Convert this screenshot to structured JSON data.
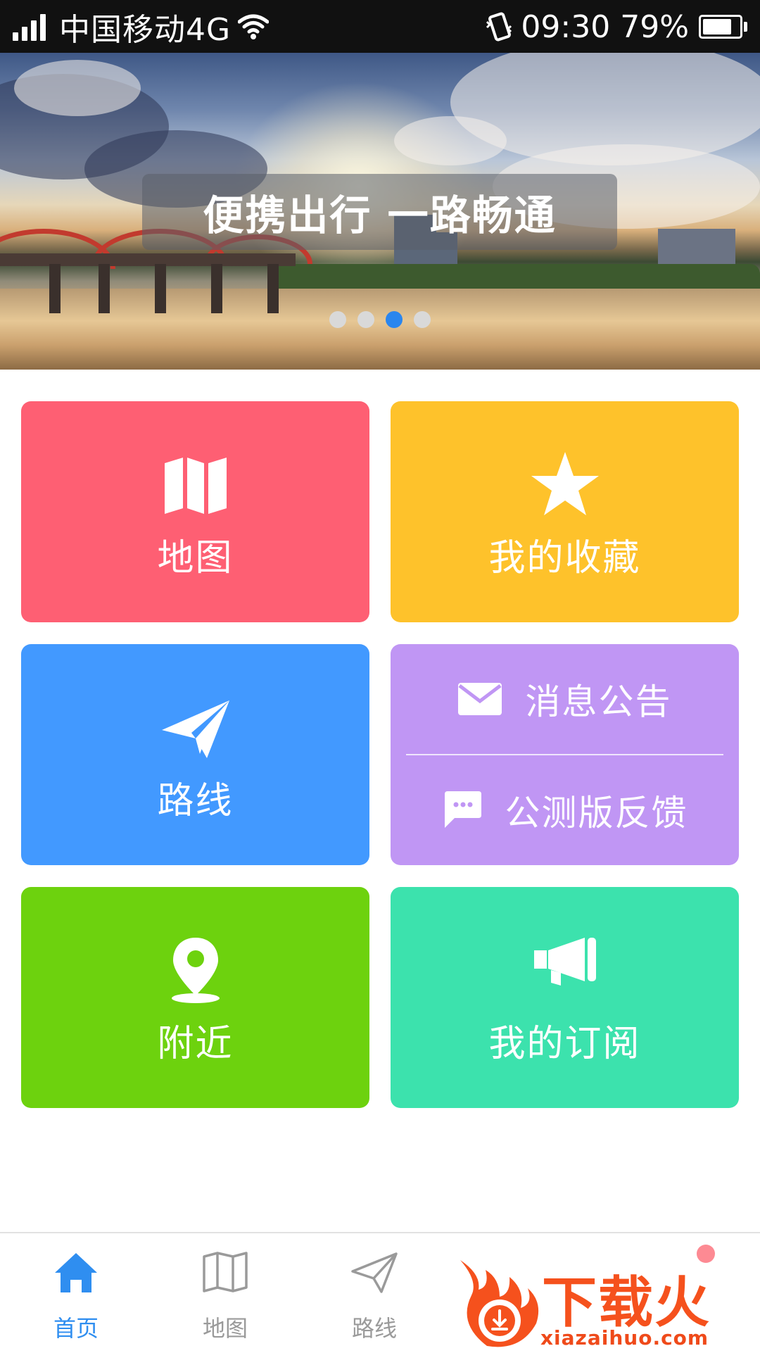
{
  "status_bar": {
    "carrier": "中国移动4G",
    "time": "09:30",
    "battery_percent": "79%",
    "battery_level": 0.79,
    "icons": [
      "signal-icon",
      "wifi-icon",
      "vibrate-icon",
      "battery-icon"
    ]
  },
  "banner": {
    "caption": "便携出行 一路畅通",
    "slide_count": 4,
    "active_slide": 3
  },
  "tiles": {
    "map": {
      "label": "地图",
      "icon": "map-icon",
      "color": "#fe5f73"
    },
    "favorites": {
      "label": "我的收藏",
      "icon": "star-icon",
      "color": "#fec22b"
    },
    "route": {
      "label": "路线",
      "icon": "paper-plane-icon",
      "color": "#4299ff"
    },
    "messages": {
      "label": "消息公告",
      "icon": "envelope-icon",
      "color": "#c096f4"
    },
    "feedback": {
      "label": "公测版反馈",
      "icon": "chat-bubble-icon",
      "color": "#c096f4"
    },
    "nearby": {
      "label": "附近",
      "icon": "location-pin-icon",
      "color": "#6dd20e"
    },
    "subscriptions": {
      "label": "我的订阅",
      "icon": "megaphone-icon",
      "color": "#3ce2ad"
    }
  },
  "bottom_nav": {
    "active_color": "#2f8ef0",
    "items": [
      {
        "label": "首页",
        "icon": "home-icon",
        "active": true
      },
      {
        "label": "地图",
        "icon": "map-icon",
        "active": false
      },
      {
        "label": "路线",
        "icon": "paper-plane-icon",
        "active": false
      }
    ]
  },
  "watermark": {
    "brand": "下载火",
    "url": "xiazaihuo.com"
  }
}
